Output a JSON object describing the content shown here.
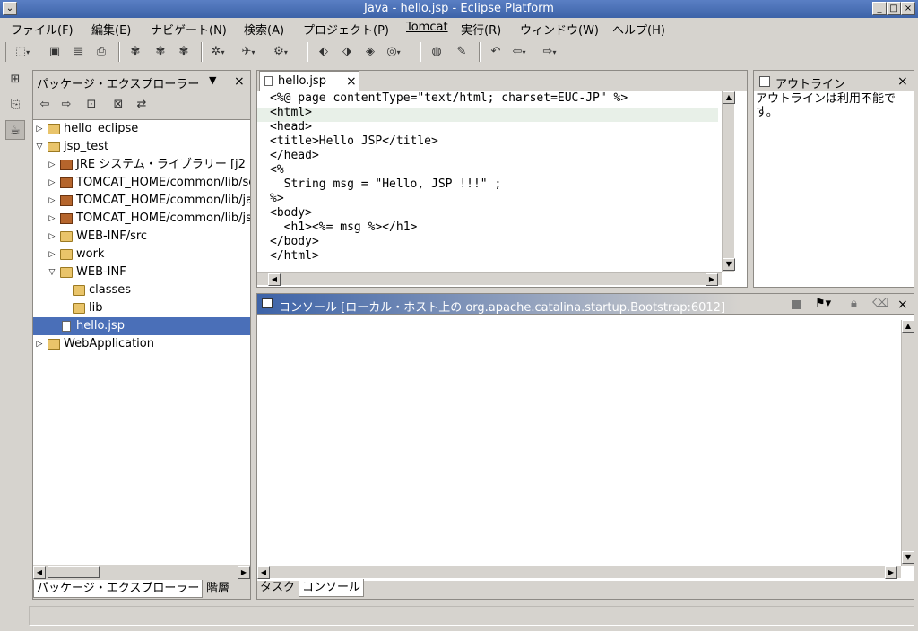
{
  "window": {
    "title": "Java - hello.jsp - Eclipse Platform"
  },
  "menu": [
    "ファイル(F)",
    "編集(E)",
    "ナビゲート(N)",
    "検索(A)",
    "プロジェクト(P)",
    "Tomcat",
    "実行(R)",
    "ウィンドウ(W)",
    "ヘルプ(H)"
  ],
  "explorer": {
    "title": "パッケージ・エクスプローラー",
    "tree": [
      {
        "label": "hello_eclipse",
        "twisty": "▷",
        "icon": "proj"
      },
      {
        "label": "jsp_test",
        "twisty": "▽",
        "icon": "proj"
      },
      {
        "label": "JRE システム・ライブラリー [j2",
        "twisty": "▷",
        "icon": "jar"
      },
      {
        "label": "TOMCAT_HOME/common/lib/servl",
        "twisty": "▷",
        "icon": "jar"
      },
      {
        "label": "TOMCAT_HOME/common/lib/jaspe",
        "twisty": "▷",
        "icon": "jar"
      },
      {
        "label": "TOMCAT_HOME/common/lib/jsp-a",
        "twisty": "▷",
        "icon": "jar"
      },
      {
        "label": "WEB-INF/src",
        "twisty": "▷",
        "icon": "folder"
      },
      {
        "label": "work",
        "twisty": "▷",
        "icon": "folder"
      },
      {
        "label": "WEB-INF",
        "twisty": "▽",
        "icon": "folder"
      },
      {
        "label": "classes",
        "twisty": "",
        "icon": "folder"
      },
      {
        "label": "lib",
        "twisty": "",
        "icon": "folder"
      },
      {
        "label": "hello.jsp",
        "twisty": "",
        "icon": "file",
        "selected": true
      },
      {
        "label": "WebApplication",
        "twisty": "▷",
        "icon": "proj"
      }
    ],
    "tabs": [
      "パッケージ・エクスプローラー",
      "階層"
    ]
  },
  "editor": {
    "tab": "hello.jsp",
    "lines": [
      "<%@ page contentType=\"text/html; charset=EUC-JP\" %>",
      "<html>",
      "<head>",
      "<title>Hello JSP</title>",
      "</head>",
      "<%",
      "  String msg = \"Hello, JSP !!!\" ;",
      "%>",
      "<body>",
      "  <h1><%= msg %></h1>",
      "</body>",
      "</html>"
    ]
  },
  "outline": {
    "title": "アウトライン",
    "message": "アウトラインは利用不能です。"
  },
  "console": {
    "title": "コンソール [ローカル・ホスト上の org.apache.catalina.startup.Bootstrap:6012]",
    "tabs": [
      "タスク",
      "コンソール"
    ]
  },
  "colors": {
    "accent": "#3d63a8",
    "selection": "#4a6fb8",
    "current_line": "#e8f0e8"
  }
}
